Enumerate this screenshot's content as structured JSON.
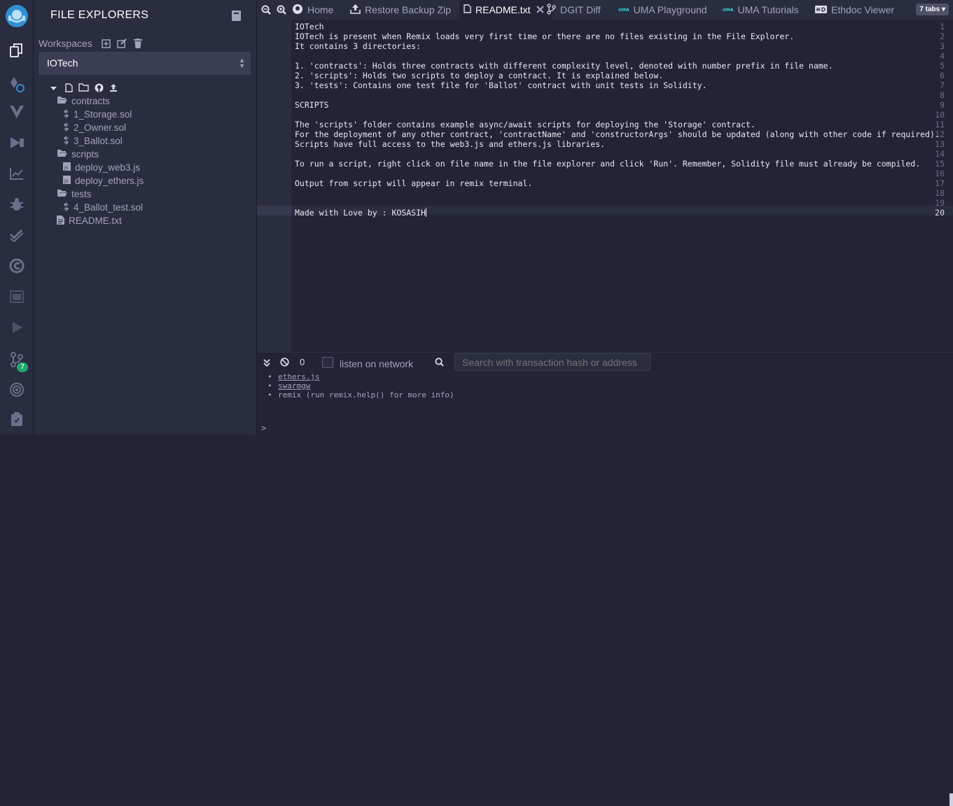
{
  "colors": {
    "accent": "#1ea96a",
    "bg": "#222336",
    "panel": "#2a2c3f"
  },
  "iconbar": {
    "items": [
      "remix-logo-icon",
      "file-explorer-icon",
      "solidity-compiler-icon",
      "vyper-icon",
      "deploy-run-icon",
      "analytics-icon",
      "debugger-icon",
      "unit-test-icon",
      "sourcify-icon",
      "terminal-panel-icon",
      "run-script-icon",
      "git-icon",
      "settings-icon",
      "plugin-manager-icon"
    ],
    "git_badge": "7"
  },
  "sidebar": {
    "title": "FILE EXPLORERS",
    "workspaces_label": "Workspaces",
    "workspace": "IOTech",
    "tree": [
      {
        "label": "contracts",
        "kind": "folder"
      },
      {
        "label": "1_Storage.sol",
        "kind": "sol"
      },
      {
        "label": "2_Owner.sol",
        "kind": "sol"
      },
      {
        "label": "3_Ballot.sol",
        "kind": "sol"
      },
      {
        "label": "scripts",
        "kind": "folder"
      },
      {
        "label": "deploy_web3.js",
        "kind": "js"
      },
      {
        "label": "deploy_ethers.js",
        "kind": "js"
      },
      {
        "label": "tests",
        "kind": "folder"
      },
      {
        "label": "4_Ballot_test.sol",
        "kind": "sol"
      },
      {
        "label": "README.txt",
        "kind": "txt"
      }
    ]
  },
  "tabs": {
    "items": [
      {
        "label": "Home"
      },
      {
        "label": "Restore Backup Zip"
      },
      {
        "label": "README.txt"
      },
      {
        "label": "DGIT Diff"
      },
      {
        "label": "UMA Playground"
      },
      {
        "label": "UMA Tutorials"
      },
      {
        "label": "Ethdoc Viewer"
      }
    ],
    "uma_logo": "UMA",
    "count": "7 tabs"
  },
  "editor": {
    "lines": [
      "IOTech",
      "IOTech is present when Remix loads very first time or there are no files existing in the File Explorer.",
      "It contains 3 directories:",
      "",
      "1. 'contracts': Holds three contracts with different complexity level, denoted with number prefix in file name.",
      "2. 'scripts': Holds two scripts to deploy a contract. It is explained below.",
      "3. 'tests': Contains one test file for 'Ballot' contract with unit tests in Solidity.",
      "",
      "SCRIPTS",
      "",
      "The 'scripts' folder contains example async/await scripts for deploying the 'Storage' contract.",
      "For the deployment of any other contract, 'contractName' and 'constructorArgs' should be updated (along with other code if required).",
      "Scripts have full access to the web3.js and ethers.js libraries.",
      "",
      "To run a script, right click on file name in the file explorer and click 'Run'. Remember, Solidity file must already be compiled.",
      "",
      "Output from script will appear in remix terminal.",
      "",
      "",
      "Made with Love by : KOSASIH"
    ],
    "line_numbers": [
      "1",
      "2",
      "3",
      "4",
      "5",
      "6",
      "7",
      "8",
      "9",
      "10",
      "11",
      "12",
      "13",
      "14",
      "15",
      "16",
      "17",
      "18",
      "19",
      "20"
    ]
  },
  "terminal": {
    "pending_count": "0",
    "listen_label": "listen on network",
    "search_placeholder": "Search with transaction hash or address",
    "output": {
      "link1": "ethers.js",
      "link2": "swarmgw",
      "line3": "remix (run remix.help() for more info)"
    },
    "prompt": ">"
  }
}
